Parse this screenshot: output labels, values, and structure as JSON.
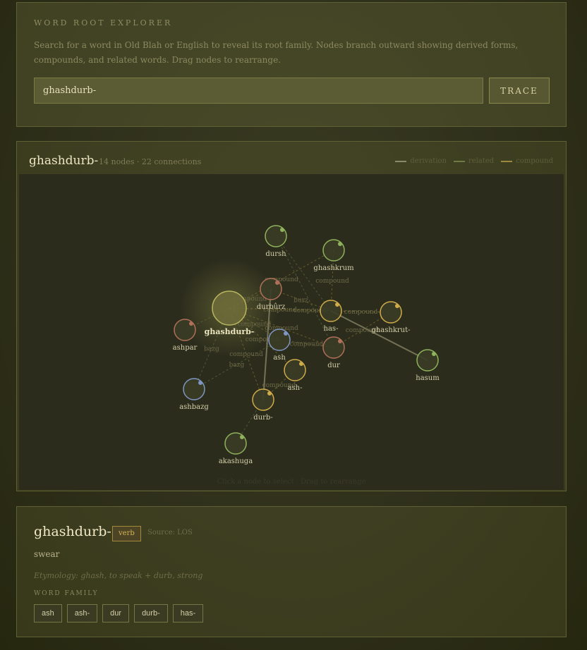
{
  "search": {
    "eyebrow": "WORD ROOT EXPLORER",
    "description": "Search for a word in Old Blah or English to reveal its root family. Nodes branch outward showing derived forms, compounds, and related words. Drag nodes to rearrange.",
    "query": "ghashdurb-",
    "button_label": "TRACE"
  },
  "graph": {
    "title": "ghashdurb-",
    "stats": "14 nodes · 22 connections",
    "legend": [
      {
        "label": "derivation",
        "color": "#8c8a6a"
      },
      {
        "label": "related",
        "color": "#6f7a45"
      },
      {
        "label": "compound",
        "color": "#9c8a3c"
      }
    ],
    "hint": "Click a node to select · Drag to rearrange",
    "colors": {
      "green": "#8fb25c",
      "red": "#b0705a",
      "blue": "#7f95c2",
      "gold": "#d0ab4a",
      "root": "#b9b65f"
    },
    "nodes": [
      {
        "id": "ghashdurb-",
        "label": "ghashdurb-",
        "color": "root",
        "root": true
      },
      {
        "id": "dursh",
        "label": "dursh",
        "color": "green"
      },
      {
        "id": "ghashkrum",
        "label": "ghashkrum",
        "color": "green"
      },
      {
        "id": "durburz",
        "label": "durbûrz",
        "color": "red"
      },
      {
        "id": "has-",
        "label": "has-",
        "color": "gold"
      },
      {
        "id": "ghashkrut-",
        "label": "ghashkrut-",
        "color": "gold"
      },
      {
        "id": "ashpar",
        "label": "ashpar",
        "color": "red"
      },
      {
        "id": "ash",
        "label": "ash",
        "color": "blue"
      },
      {
        "id": "dur",
        "label": "dur",
        "color": "red"
      },
      {
        "id": "hasum",
        "label": "hasum",
        "color": "green"
      },
      {
        "id": "ash-",
        "label": "ash-",
        "color": "gold"
      },
      {
        "id": "ashbazg",
        "label": "ashbazg",
        "color": "blue"
      },
      {
        "id": "durb-",
        "label": "durb-",
        "color": "gold"
      },
      {
        "id": "akashuga",
        "label": "akashuga",
        "color": "green"
      }
    ],
    "edges": [
      {
        "from": "ghashdurb-",
        "to": "ghashkrum",
        "type": "compound",
        "label": "compound"
      },
      {
        "from": "ghashdurb-",
        "to": "durburz",
        "type": "compound",
        "label": "compound"
      },
      {
        "from": "ghashdurb-",
        "to": "has-",
        "type": "compound",
        "label": "compound"
      },
      {
        "from": "ghashdurb-",
        "to": "ash",
        "type": "compound",
        "label": "compound"
      },
      {
        "from": "ghashdurb-",
        "to": "ashpar",
        "type": "related",
        "label": ""
      },
      {
        "from": "ghashdurb-",
        "to": "dur",
        "type": "compound",
        "label": "compound"
      },
      {
        "from": "ghashdurb-",
        "to": "ash-",
        "type": "compound",
        "label": "compound"
      },
      {
        "from": "ghashdurb-",
        "to": "ashbazg",
        "type": "related",
        "label": "bazg"
      },
      {
        "from": "ghashdurb-",
        "to": "durb-",
        "type": "compound",
        "label": "compound"
      },
      {
        "from": "ghashdurb-",
        "to": "ghashkrut-",
        "type": "compound",
        "label": "compound"
      },
      {
        "from": "dursh",
        "to": "dur",
        "type": "related",
        "label": ""
      },
      {
        "from": "dursh",
        "to": "has-",
        "type": "related",
        "label": ""
      },
      {
        "from": "ghashkrum",
        "to": "has-",
        "type": "compound",
        "label": "compound"
      },
      {
        "from": "has-",
        "to": "ghashkrut-",
        "type": "compound",
        "label": "compound"
      },
      {
        "from": "has-",
        "to": "hasum",
        "type": "derivation",
        "label": ""
      },
      {
        "from": "durburz",
        "to": "durb-",
        "type": "derivation",
        "label": ""
      },
      {
        "from": "durburz",
        "to": "has-",
        "type": "compound",
        "label": "burz"
      },
      {
        "from": "ash",
        "to": "dur",
        "type": "compound",
        "label": "compound"
      },
      {
        "from": "ash",
        "to": "ashbazg",
        "type": "related",
        "label": "bazg"
      },
      {
        "from": "ash-",
        "to": "durb-",
        "type": "compound",
        "label": "compound"
      },
      {
        "from": "durb-",
        "to": "akashuga",
        "type": "related",
        "label": ""
      },
      {
        "from": "dur",
        "to": "ghashkrut-",
        "type": "compound",
        "label": "compound"
      }
    ]
  },
  "detail": {
    "word": "ghashdurb-",
    "pos": "verb",
    "source": "Source: LOS",
    "gloss": "swear",
    "etymology": "Etymology: ghash, to speak + durb, strong",
    "family_label": "WORD FAMILY",
    "family": [
      "ash",
      "ash-",
      "dur",
      "durb-",
      "has-"
    ]
  }
}
